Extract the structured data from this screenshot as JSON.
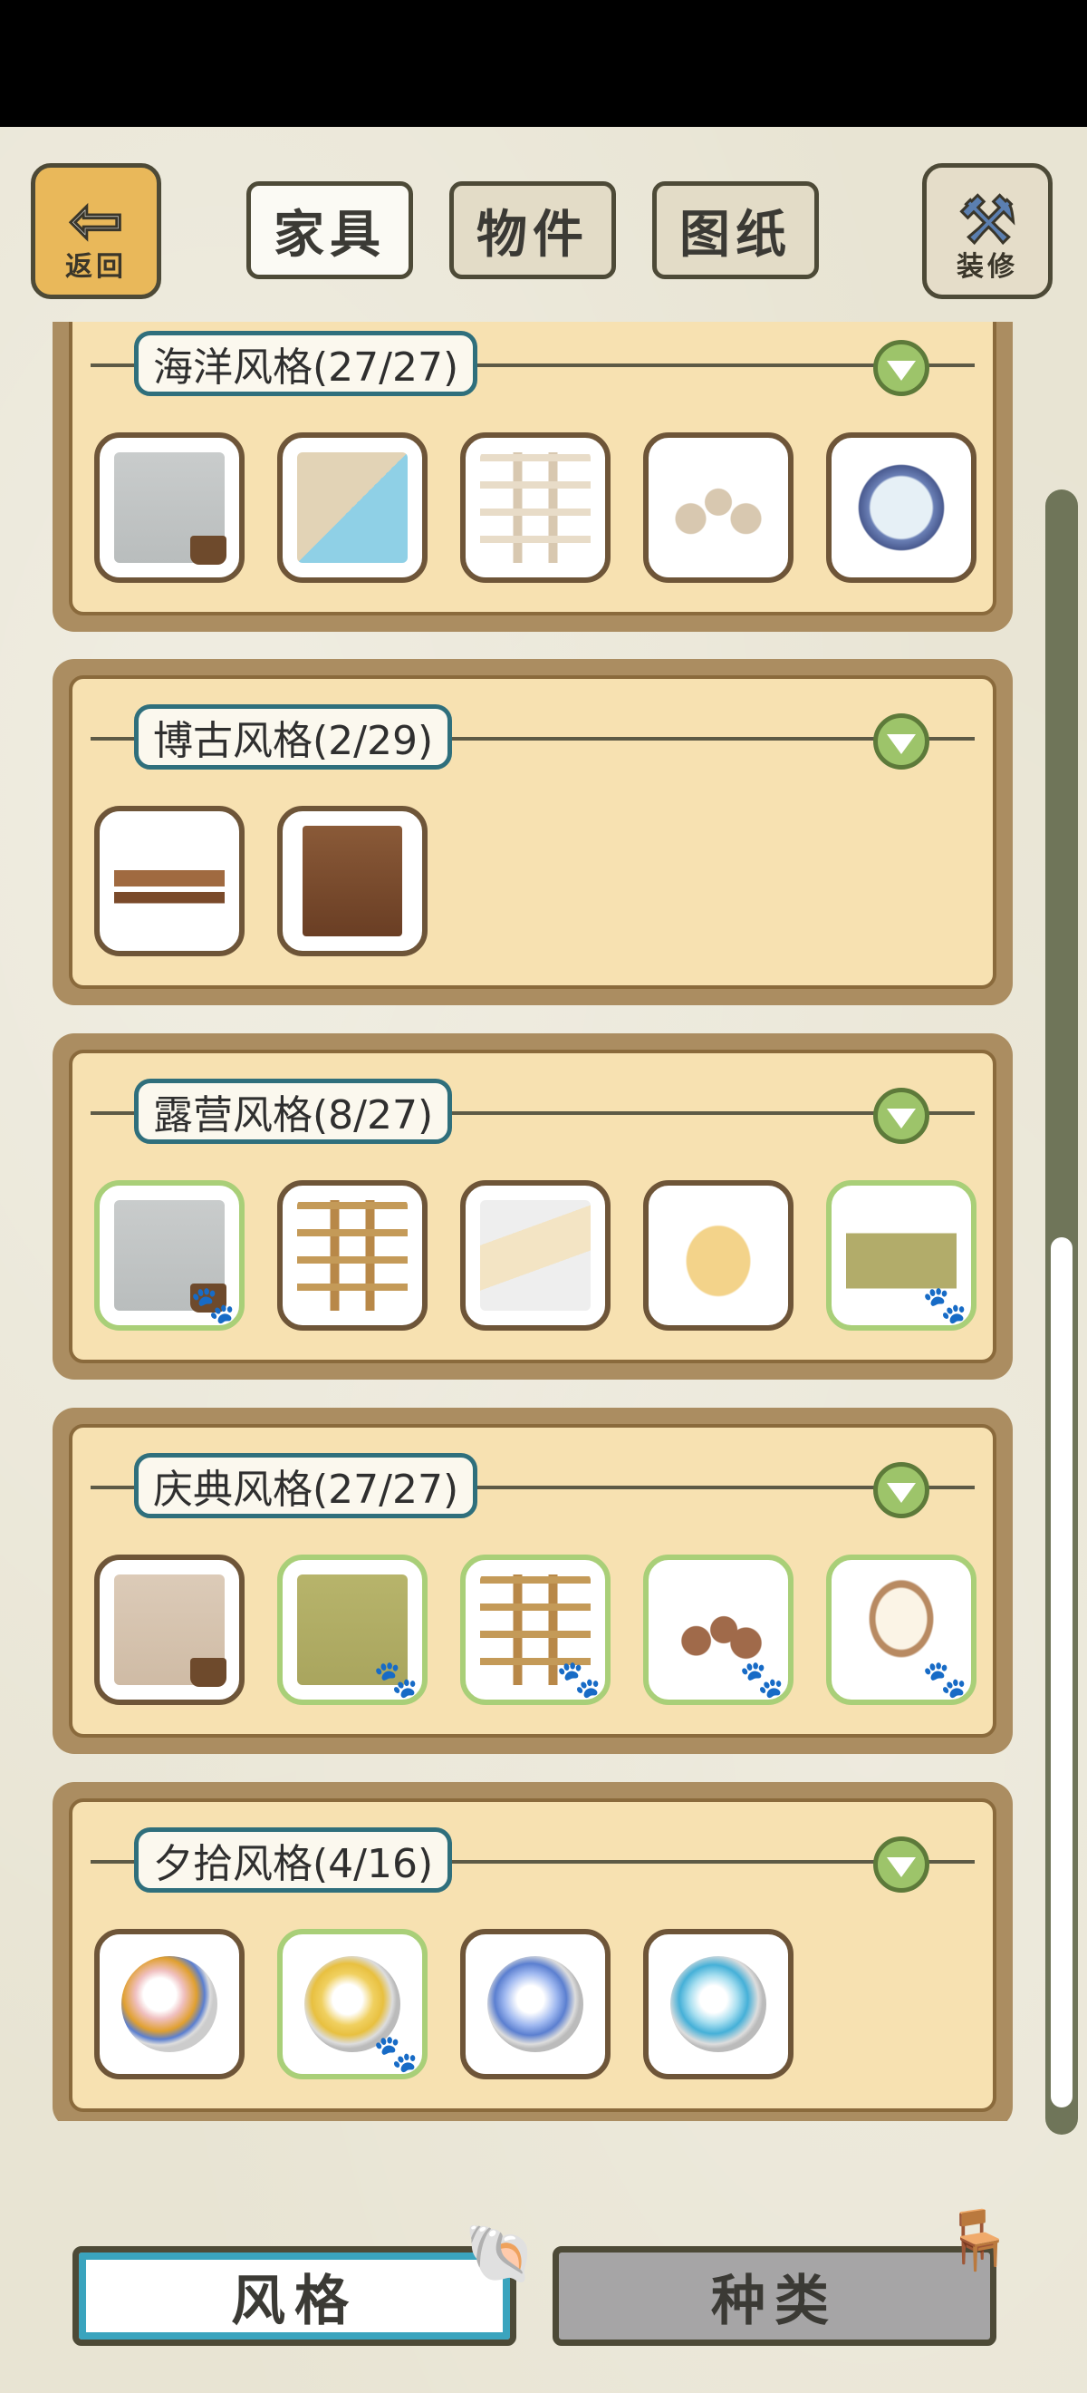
{
  "header": {
    "back_label": "返回",
    "back_icon": "left-arrow-icon",
    "decor_label": "装修",
    "decor_icon": "hammer-icon",
    "tabs": [
      {
        "label": "家具",
        "active": true
      },
      {
        "label": "物件",
        "active": false
      },
      {
        "label": "图纸",
        "active": false
      }
    ]
  },
  "sections": [
    {
      "title": "海洋风格(27/27)",
      "items": [
        {
          "icon": "wall-with-tub",
          "owned": false
        },
        {
          "icon": "pool-floor",
          "owned": false
        },
        {
          "icon": "white-ladder",
          "owned": false
        },
        {
          "icon": "stone-arch",
          "owned": false
        },
        {
          "icon": "porthole-mirror",
          "owned": false
        }
      ]
    },
    {
      "title": "博古风格(2/29)",
      "items": [
        {
          "icon": "low-table",
          "owned": false
        },
        {
          "icon": "wooden-cabinet",
          "owned": false
        }
      ]
    },
    {
      "title": "露营风格(8/27)",
      "items": [
        {
          "icon": "wall-with-tub",
          "owned": true
        },
        {
          "icon": "wooden-ladder",
          "owned": false
        },
        {
          "icon": "tent",
          "owned": false
        },
        {
          "icon": "sleeping-bag",
          "owned": false
        },
        {
          "icon": "storage-box",
          "owned": true
        }
      ]
    },
    {
      "title": "庆典风格(27/27)",
      "items": [
        {
          "icon": "wall-with-tub",
          "owned": false
        },
        {
          "icon": "grass-wall",
          "owned": true
        },
        {
          "icon": "moss-ladder",
          "owned": true
        },
        {
          "icon": "clay-pots",
          "owned": true
        },
        {
          "icon": "arched-window",
          "owned": true
        }
      ]
    },
    {
      "title": "夕拾风格(4/16)",
      "items": [
        {
          "icon": "marble-red",
          "owned": false
        },
        {
          "icon": "marble-yellow",
          "owned": true
        },
        {
          "icon": "marble-blue",
          "owned": false
        },
        {
          "icon": "marble-cyan",
          "owned": false
        }
      ]
    }
  ],
  "bottom_tabs": [
    {
      "label": "风格",
      "active": true,
      "icon": "shell-icon"
    },
    {
      "label": "种类",
      "active": false,
      "icon": "chair-icon"
    }
  ],
  "colors": {
    "panel_bg": "#f7e1b1",
    "panel_frame": "#ab8d61",
    "title_border": "#2f6f7c",
    "owned_border": "#a9cf78",
    "active_tab_border": "#3aa4be"
  }
}
